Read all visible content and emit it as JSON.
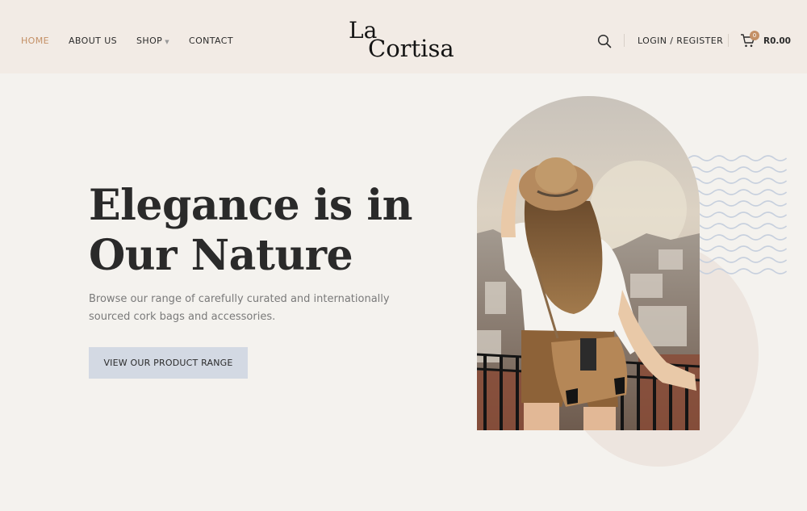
{
  "header": {
    "nav": [
      {
        "label": "HOME",
        "active": true
      },
      {
        "label": "ABOUT US",
        "active": false
      },
      {
        "label": "SHOP",
        "active": false,
        "has_dropdown": true
      },
      {
        "label": "CONTACT",
        "active": false
      }
    ],
    "logo": {
      "line1": "La",
      "line2": "Cortisa"
    },
    "login_label": "LOGIN / REGISTER",
    "cart": {
      "count": "0",
      "total": "R0.00"
    },
    "icons": {
      "search": "search-icon",
      "cart": "cart-icon",
      "dropdown": "chevron-down-icon"
    }
  },
  "hero": {
    "title": "Elegance is in Our Nature",
    "subtitle": "Browse our range of carefully curated and internationally sourced cork bags and accessories.",
    "button_label": "VIEW OUR PRODUCT RANGE"
  },
  "colors": {
    "accent": "#c49066",
    "header_bg": "#f2ebe5",
    "page_bg": "#f4f2ee",
    "button_bg": "#d3d9e3",
    "wave": "#c7d0de"
  }
}
